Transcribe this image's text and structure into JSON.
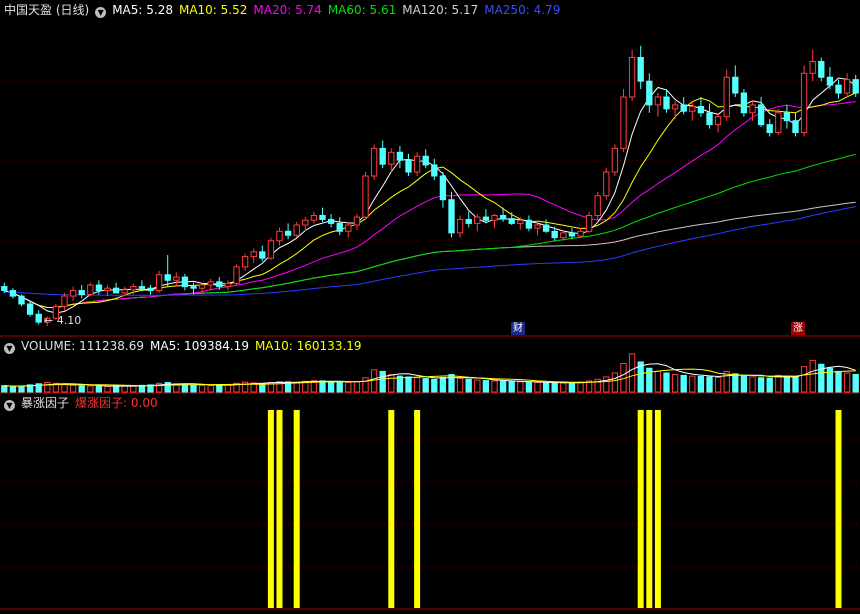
{
  "price_panel": {
    "title": "中国天盈 (日线)",
    "ma5": "MA5: 5.28",
    "ma10": "MA10: 5.52",
    "ma20": "MA20: 5.74",
    "ma60": "MA60: 5.61",
    "ma120": "MA120: 5.17",
    "ma250": "MA250: 4.79",
    "low_label": "4.10",
    "event_left": "财",
    "event_right": "涨"
  },
  "volume_panel": {
    "title": "VOLUME: 111238.69",
    "ma5": "MA5: 109384.19",
    "ma10": "MA10: 160133.19"
  },
  "factor_panel": {
    "title": "暴涨因子",
    "value": "爆涨因子: 0.00"
  },
  "icons": {
    "panel_control": "chevron-down-icon"
  },
  "colors": {
    "up": "#ff3c3c",
    "down": "#54ffff",
    "ma5": "#ffffff",
    "ma10": "#ffff00",
    "ma20": "#ff00ff",
    "ma60": "#00e000",
    "ma120": "#c8c8c8",
    "ma250": "#2a3cff",
    "factor_bar": "#ffff00",
    "grid": "#7a0000",
    "axis": "#b00000"
  },
  "chart_data": {
    "type": "candlestick",
    "price_range": [
      4.0,
      8.0
    ],
    "candles_ohlc": [
      [
        4.6,
        4.65,
        4.52,
        4.55
      ],
      [
        4.55,
        4.58,
        4.45,
        4.48
      ],
      [
        4.48,
        4.5,
        4.35,
        4.38
      ],
      [
        4.38,
        4.42,
        4.22,
        4.25
      ],
      [
        4.25,
        4.3,
        4.12,
        4.15
      ],
      [
        4.15,
        4.22,
        4.1,
        4.2
      ],
      [
        4.2,
        4.38,
        4.18,
        4.35
      ],
      [
        4.35,
        4.52,
        4.3,
        4.48
      ],
      [
        4.48,
        4.6,
        4.42,
        4.55
      ],
      [
        4.55,
        4.62,
        4.45,
        4.5
      ],
      [
        4.5,
        4.65,
        4.48,
        4.62
      ],
      [
        4.62,
        4.68,
        4.5,
        4.55
      ],
      [
        4.55,
        4.62,
        4.48,
        4.58
      ],
      [
        4.58,
        4.65,
        4.52,
        4.52
      ],
      [
        4.52,
        4.6,
        4.48,
        4.56
      ],
      [
        4.56,
        4.64,
        4.5,
        4.6
      ],
      [
        4.6,
        4.68,
        4.54,
        4.58
      ],
      [
        4.58,
        4.62,
        4.5,
        4.55
      ],
      [
        4.55,
        4.8,
        4.52,
        4.75
      ],
      [
        4.75,
        5.0,
        4.6,
        4.68
      ],
      [
        4.68,
        4.78,
        4.6,
        4.72
      ],
      [
        4.72,
        4.76,
        4.55,
        4.6
      ],
      [
        4.6,
        4.65,
        4.5,
        4.58
      ],
      [
        4.58,
        4.64,
        4.52,
        4.62
      ],
      [
        4.62,
        4.7,
        4.55,
        4.66
      ],
      [
        4.66,
        4.72,
        4.56,
        4.6
      ],
      [
        4.6,
        4.68,
        4.55,
        4.64
      ],
      [
        4.64,
        4.88,
        4.62,
        4.85
      ],
      [
        4.85,
        5.02,
        4.8,
        4.98
      ],
      [
        4.98,
        5.08,
        4.9,
        5.04
      ],
      [
        5.04,
        5.12,
        4.92,
        4.96
      ],
      [
        4.96,
        5.22,
        4.94,
        5.18
      ],
      [
        5.18,
        5.35,
        5.12,
        5.3
      ],
      [
        5.3,
        5.4,
        5.2,
        5.25
      ],
      [
        5.25,
        5.42,
        5.22,
        5.38
      ],
      [
        5.38,
        5.48,
        5.3,
        5.44
      ],
      [
        5.44,
        5.55,
        5.4,
        5.5
      ],
      [
        5.5,
        5.6,
        5.42,
        5.45
      ],
      [
        5.45,
        5.52,
        5.35,
        5.4
      ],
      [
        5.4,
        5.48,
        5.25,
        5.3
      ],
      [
        5.3,
        5.42,
        5.22,
        5.38
      ],
      [
        5.38,
        5.52,
        5.32,
        5.48
      ],
      [
        5.48,
        6.05,
        5.45,
        6.0
      ],
      [
        6.0,
        6.4,
        5.95,
        6.35
      ],
      [
        6.35,
        6.45,
        6.1,
        6.15
      ],
      [
        6.15,
        6.35,
        6.05,
        6.3
      ],
      [
        6.3,
        6.38,
        6.1,
        6.2
      ],
      [
        6.2,
        6.28,
        6.0,
        6.05
      ],
      [
        6.05,
        6.3,
        6.0,
        6.25
      ],
      [
        6.25,
        6.34,
        6.1,
        6.14
      ],
      [
        6.14,
        6.22,
        5.95,
        6.0
      ],
      [
        6.0,
        6.05,
        5.6,
        5.7
      ],
      [
        5.7,
        5.8,
        5.22,
        5.28
      ],
      [
        5.28,
        5.5,
        5.22,
        5.45
      ],
      [
        5.45,
        5.55,
        5.35,
        5.4
      ],
      [
        5.4,
        5.52,
        5.3,
        5.48
      ],
      [
        5.48,
        5.58,
        5.4,
        5.44
      ],
      [
        5.44,
        5.52,
        5.34,
        5.5
      ],
      [
        5.5,
        5.6,
        5.42,
        5.46
      ],
      [
        5.46,
        5.54,
        5.38,
        5.4
      ],
      [
        5.4,
        5.48,
        5.32,
        5.44
      ],
      [
        5.44,
        5.5,
        5.3,
        5.34
      ],
      [
        5.34,
        5.44,
        5.25,
        5.38
      ],
      [
        5.38,
        5.45,
        5.28,
        5.3
      ],
      [
        5.3,
        5.36,
        5.18,
        5.22
      ],
      [
        5.22,
        5.32,
        5.18,
        5.28
      ],
      [
        5.28,
        5.34,
        5.2,
        5.24
      ],
      [
        5.24,
        5.34,
        5.22,
        5.3
      ],
      [
        5.3,
        5.55,
        5.28,
        5.5
      ],
      [
        5.5,
        5.8,
        5.45,
        5.75
      ],
      [
        5.75,
        6.1,
        5.7,
        6.05
      ],
      [
        6.05,
        6.4,
        6.0,
        6.35
      ],
      [
        6.35,
        7.1,
        6.3,
        7.0
      ],
      [
        7.0,
        7.6,
        6.95,
        7.5
      ],
      [
        7.5,
        7.65,
        7.1,
        7.2
      ],
      [
        7.2,
        7.3,
        6.8,
        6.9
      ],
      [
        6.9,
        7.05,
        6.75,
        7.0
      ],
      [
        7.0,
        7.1,
        6.8,
        6.85
      ],
      [
        6.85,
        6.95,
        6.72,
        6.9
      ],
      [
        6.9,
        7.0,
        6.78,
        6.82
      ],
      [
        6.82,
        6.95,
        6.7,
        6.88
      ],
      [
        6.88,
        7.0,
        6.75,
        6.8
      ],
      [
        6.8,
        6.92,
        6.6,
        6.65
      ],
      [
        6.65,
        6.8,
        6.55,
        6.75
      ],
      [
        6.75,
        7.35,
        6.7,
        7.25
      ],
      [
        7.25,
        7.4,
        7.0,
        7.05
      ],
      [
        7.05,
        7.1,
        6.75,
        6.8
      ],
      [
        6.8,
        6.95,
        6.7,
        6.9
      ],
      [
        6.9,
        7.0,
        6.62,
        6.65
      ],
      [
        6.65,
        6.72,
        6.5,
        6.55
      ],
      [
        6.55,
        6.85,
        6.52,
        6.8
      ],
      [
        6.8,
        6.9,
        6.6,
        6.7
      ],
      [
        6.7,
        6.8,
        6.5,
        6.55
      ],
      [
        6.55,
        7.4,
        6.5,
        7.3
      ],
      [
        7.3,
        7.6,
        7.2,
        7.45
      ],
      [
        7.45,
        7.5,
        7.2,
        7.25
      ],
      [
        7.25,
        7.38,
        7.1,
        7.15
      ],
      [
        7.15,
        7.22,
        6.98,
        7.05
      ],
      [
        7.05,
        7.3,
        7.0,
        7.22
      ],
      [
        7.22,
        7.28,
        7.0,
        7.05
      ]
    ],
    "volume": [
      40,
      35,
      38,
      45,
      52,
      60,
      55,
      48,
      42,
      40,
      38,
      36,
      35,
      37,
      39,
      40,
      42,
      45,
      55,
      60,
      50,
      48,
      45,
      42,
      40,
      44,
      46,
      55,
      62,
      58,
      54,
      60,
      66,
      64,
      62,
      68,
      72,
      70,
      66,
      62,
      60,
      64,
      90,
      140,
      130,
      110,
      100,
      95,
      90,
      85,
      80,
      92,
      110,
      86,
      80,
      75,
      72,
      70,
      68,
      66,
      64,
      62,
      60,
      58,
      56,
      58,
      60,
      62,
      70,
      80,
      95,
      120,
      180,
      240,
      190,
      150,
      130,
      120,
      110,
      105,
      100,
      98,
      95,
      92,
      130,
      115,
      100,
      95,
      90,
      88,
      105,
      98,
      94,
      160,
      200,
      175,
      150,
      130,
      120,
      111
    ],
    "factor_signal_indices": [
      31,
      32,
      34,
      45,
      48,
      74,
      75,
      76,
      97
    ],
    "factor_range": [
      0,
      1
    ]
  }
}
